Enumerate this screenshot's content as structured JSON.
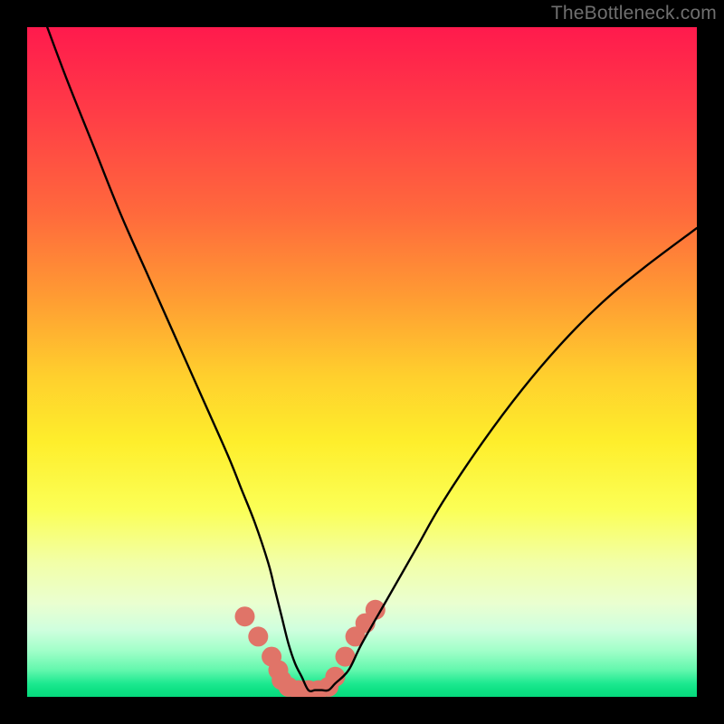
{
  "watermark": "TheBottleneck.com",
  "chart_data": {
    "type": "line",
    "title": "",
    "xlabel": "",
    "ylabel": "",
    "xlim": [
      0,
      100
    ],
    "ylim": [
      0,
      100
    ],
    "grid": false,
    "legend": false,
    "series": [
      {
        "name": "bottleneck-curve",
        "x": [
          3,
          6,
          10,
          14,
          18,
          22,
          26,
          30,
          32,
          34,
          36,
          37,
          38,
          39,
          40,
          41,
          42,
          43,
          44,
          45,
          46,
          48,
          50,
          54,
          58,
          62,
          68,
          74,
          80,
          86,
          92,
          100
        ],
        "y": [
          100,
          92,
          82,
          72,
          63,
          54,
          45,
          36,
          31,
          26,
          20,
          16,
          12,
          8,
          5,
          3,
          1,
          1,
          1,
          1,
          2,
          4,
          8,
          15,
          22,
          29,
          38,
          46,
          53,
          59,
          64,
          70
        ]
      }
    ],
    "highlight_points": {
      "name": "highlighted-segment",
      "color": "#e07468",
      "x": [
        32.5,
        34.5,
        36.5,
        37.5,
        38.0,
        39.0,
        40.5,
        42.0,
        43.5,
        45.0,
        46.0,
        47.5,
        49.0,
        50.5,
        52.0
      ],
      "y": [
        12,
        9,
        6,
        4,
        2.5,
        1.5,
        1,
        1,
        1,
        1.5,
        3,
        6,
        9,
        11,
        13
      ]
    }
  }
}
